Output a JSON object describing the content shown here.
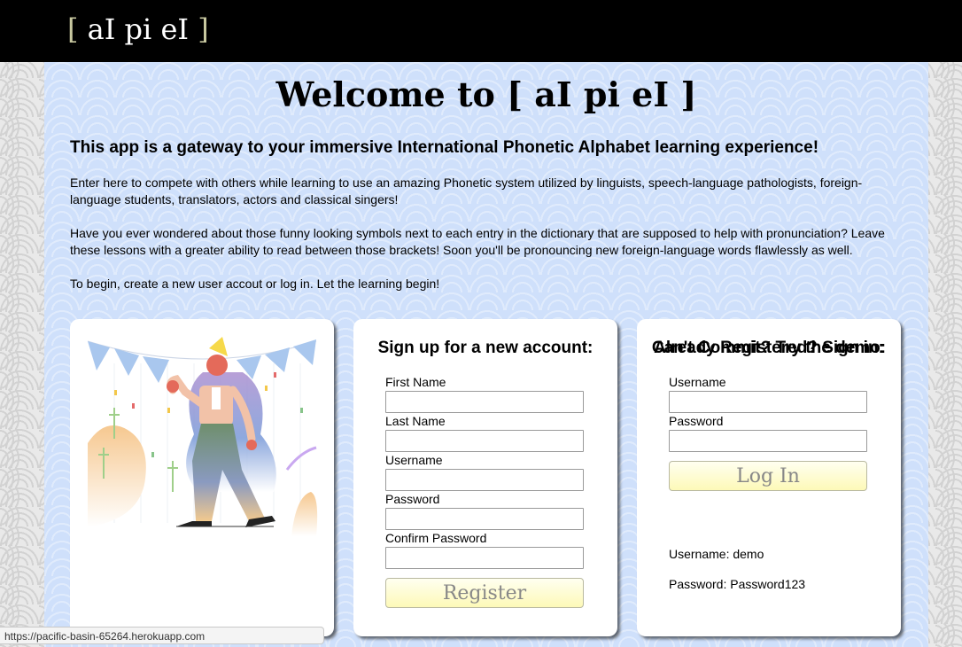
{
  "navbar": {
    "logo_open": "[",
    "logo_text": " aI pi eI ",
    "logo_close": "]"
  },
  "main": {
    "title": "Welcome to [ aI pi eI ]",
    "subtitle": "This app is a gateway to your immersive International Phonetic Alphabet learning experience!",
    "paragraphs": [
      "Enter here to compete with others while learning to use an amazing Phonetic system utilized by linguists, speech-language pathologists, foreign-language students, translators, actors and classical singers!",
      "Have you ever wondered about those funny looking symbols next to each entry in the dictionary that are supposed to help with pronunciation? Leave these lessons with a greater ability to read between those brackets! Soon you'll be pronouncing new foreign-language words flawlessly as well.",
      "To begin, create a new user accout or log in. Let the learning begin!"
    ]
  },
  "signup": {
    "heading": "Sign up for a new account:",
    "fields": [
      {
        "label": "First Name",
        "value": ""
      },
      {
        "label": "Last Name",
        "value": ""
      },
      {
        "label": "Username",
        "value": ""
      },
      {
        "label": "Password",
        "value": ""
      },
      {
        "label": "Confirm Password",
        "value": ""
      }
    ],
    "button": "Register"
  },
  "signin": {
    "heading": "Already Registered? Sign in:",
    "fields": [
      {
        "label": "Username",
        "value": ""
      },
      {
        "label": "Password",
        "value": ""
      }
    ],
    "button": "Log In",
    "demo_heading": "Can't Commit? Try the demo:",
    "demo_username": "Username: demo",
    "demo_password": "Password: Password123"
  },
  "illustration": {
    "icon": "celebrating-person-illustration"
  },
  "status_bar": {
    "url": "https://pacific-basin-65264.herokuapp.com"
  },
  "colors": {
    "panel": "#cfe0fb",
    "button": "#fdf9b8",
    "navbar": "#000000"
  }
}
